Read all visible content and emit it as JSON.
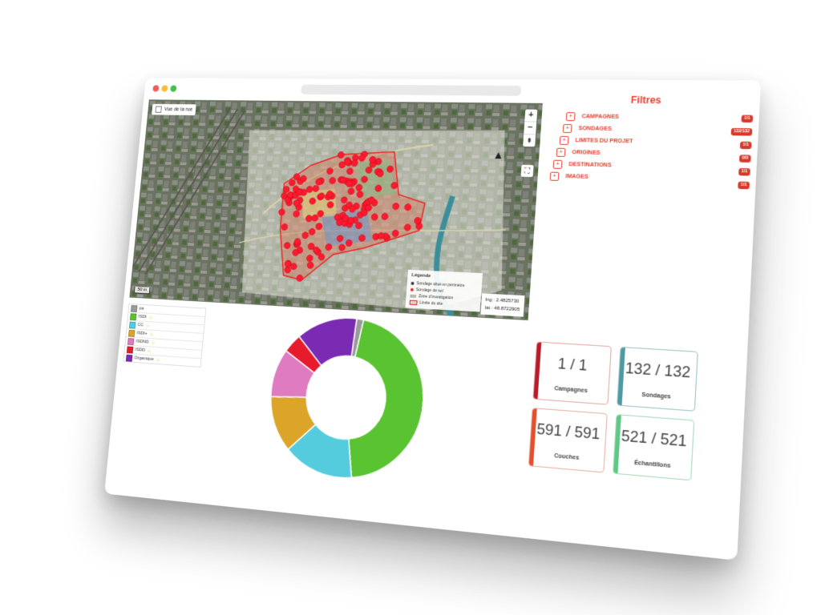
{
  "map": {
    "street_view_label": "Vue de la rue",
    "zoom_in": "+",
    "zoom_out": "−",
    "reset_north": "⇞",
    "fullscreen": "⛶",
    "scale": "50 m",
    "coords": {
      "lng": "lng : 2.4825730",
      "lat": "lat : 48.8722905"
    },
    "legend": {
      "title": "Légende",
      "items": [
        "Sondage situé en périmètre",
        "Sondage de sol",
        "Zone d'investigation",
        "Limite du site"
      ]
    }
  },
  "filters": {
    "title": "Filtres",
    "items": [
      {
        "label": "CAMPAGNES",
        "badge": "1/1"
      },
      {
        "label": "SONDAGES",
        "badge": "132/132"
      },
      {
        "label": "LIMITES DU PROJET",
        "badge": "1/1"
      },
      {
        "label": "ORIGINES",
        "badge": "0/0"
      },
      {
        "label": "DESTINATIONS",
        "badge": "1/1"
      },
      {
        "label": "IMAGES",
        "badge": "1/1"
      }
    ]
  },
  "categories": [
    {
      "label": "pa",
      "color": "#9a9a9a",
      "star": ""
    },
    {
      "label": "ISDI",
      "color": "#59c331",
      "star": "☆"
    },
    {
      "label": "CC",
      "color": "#55ccdd",
      "star": "☆"
    },
    {
      "label": "ISDI+",
      "color": "#dca52a",
      "star": "☆"
    },
    {
      "label": "ISDND",
      "color": "#de7cbf",
      "star": "☆"
    },
    {
      "label": "ISDD",
      "color": "#e61c2c",
      "star": "☆"
    },
    {
      "label": "Organique",
      "color": "#7b2bb3",
      "star": "☆"
    }
  ],
  "chart_data": {
    "type": "pie",
    "donut": true,
    "categories": [
      "pa",
      "ISDI",
      "CC",
      "ISDI+",
      "ISDND",
      "ISDD",
      "Organique"
    ],
    "values": [
      1.5,
      45,
      15,
      11.5,
      10,
      4,
      13
    ],
    "colors": [
      "#9a9a9a",
      "#59c331",
      "#55ccdd",
      "#dca52a",
      "#de7cbf",
      "#e61c2c",
      "#7b2bb3"
    ]
  },
  "stats": [
    {
      "value": "1 / 1",
      "label": "Campagnes",
      "color": "#b71c2a"
    },
    {
      "value": "132 / 132",
      "label": "Sondages",
      "color": "#4e9aa0"
    },
    {
      "value": "591 / 591",
      "label": "Couches",
      "color": "#e4502f"
    },
    {
      "value": "521 / 521",
      "label": "Échantillons",
      "color": "#5ec985"
    }
  ]
}
